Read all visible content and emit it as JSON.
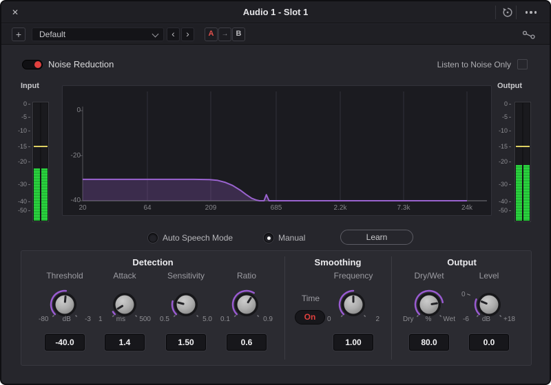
{
  "colors": {
    "accent_purple": "#9a5bd2",
    "accent_red": "#e0403e",
    "meter_green": "#2ad33e",
    "peak_yellow": "#ded063",
    "curve_stroke": "#9a63cf",
    "curve_fill": "rgba(145,90,190,0.28)"
  },
  "titlebar": {
    "title": "Audio 1 - Slot 1",
    "close": "✕"
  },
  "toolbar": {
    "add": "+",
    "preset": "Default",
    "prev": "‹",
    "next": "›",
    "a": "A",
    "arrow": "→",
    "b": "B"
  },
  "header": {
    "plugin": "Noise Reduction",
    "listen": "Listen to Noise Only"
  },
  "meters": {
    "input": {
      "label": "Input",
      "scale": [
        "0",
        "-5",
        "-10",
        "-15",
        "-20",
        "-30",
        "-40",
        "-50"
      ],
      "level_percent": 44.5,
      "peak_percent": 36.5
    },
    "output": {
      "label": "Output",
      "scale": [
        "0",
        "-5",
        "-10",
        "-15",
        "-20",
        "-30",
        "-40",
        "-50"
      ],
      "level_percent": 47.5,
      "peak_percent": 36.5
    }
  },
  "spectrum": {
    "x_labels": [
      "20",
      "64",
      "209",
      "685",
      "2.2k",
      "7.3k",
      "24k"
    ],
    "y_labels": [
      "0",
      "-20",
      "-40"
    ],
    "points": [
      [
        0,
        -30.5
      ],
      [
        0.29,
        -30.5
      ],
      [
        0.33,
        -30.6
      ],
      [
        0.35,
        -30.9
      ],
      [
        0.37,
        -31.8
      ],
      [
        0.39,
        -33.2
      ],
      [
        0.41,
        -35.3
      ],
      [
        0.425,
        -37.2
      ],
      [
        0.44,
        -38.9
      ],
      [
        0.452,
        -39.7
      ],
      [
        0.46,
        -40
      ],
      [
        0.472,
        -40
      ],
      [
        0.478,
        -37.3
      ],
      [
        0.485,
        -40
      ],
      [
        1,
        -40
      ]
    ]
  },
  "mode": {
    "auto": "Auto Speech Mode",
    "manual": "Manual",
    "selected": "Manual",
    "learn": "Learn"
  },
  "controls": {
    "detection": {
      "title": "Detection",
      "threshold": {
        "label": "Threshold",
        "min": "-80",
        "unit": "dB",
        "max": "-3",
        "value": "-40.0",
        "fraction": 0.52
      },
      "attack": {
        "label": "Attack",
        "min": "1",
        "unit": "ms",
        "max": "500",
        "value": "1.4",
        "fraction": 0.05
      },
      "sensitivity": {
        "label": "Sensitivity",
        "min": "0.5",
        "unit": "",
        "max": "5.0",
        "value": "1.50",
        "fraction": 0.22
      },
      "ratio": {
        "label": "Ratio",
        "min": "0.1",
        "unit": "",
        "max": "0.9",
        "value": "0.6",
        "fraction": 0.62
      }
    },
    "smoothing": {
      "title": "Smoothing",
      "time_label": "Time",
      "time_value": "On",
      "frequency": {
        "label": "Frequency",
        "min": "0",
        "unit": "",
        "max": "2",
        "value": "1.00",
        "fraction": 0.5
      }
    },
    "output": {
      "title": "Output",
      "drywet": {
        "label": "Dry/Wet",
        "min": "Dry",
        "unit": "%",
        "max": "Wet",
        "value": "80.0",
        "fraction": 0.8
      },
      "level": {
        "label": "Level",
        "min": "-6",
        "unit": "dB",
        "max": "+18",
        "value": "0.0",
        "fraction": 0.25,
        "marker": "0"
      }
    }
  }
}
